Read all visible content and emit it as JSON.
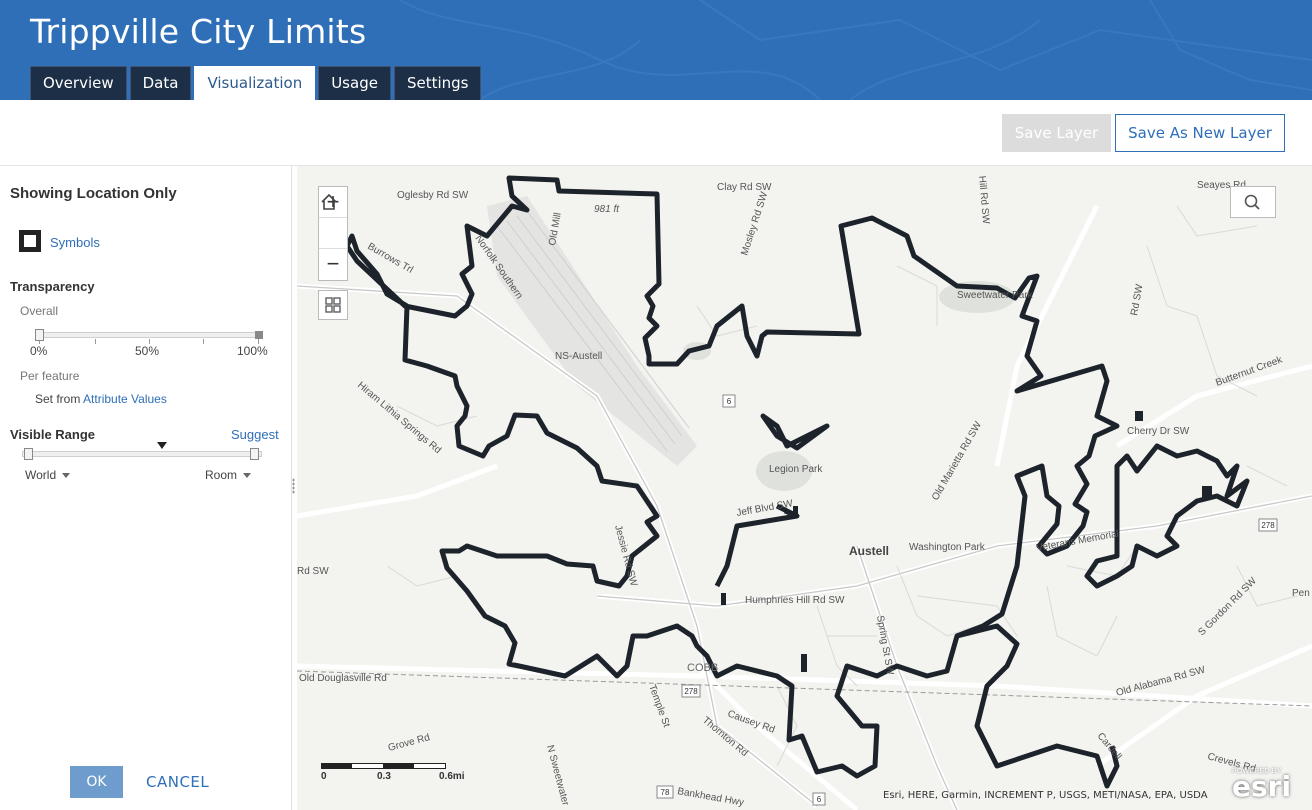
{
  "header": {
    "title": "Trippville City Limits",
    "tabs": [
      {
        "label": "Overview",
        "active": false
      },
      {
        "label": "Data",
        "active": false
      },
      {
        "label": "Visualization",
        "active": true
      },
      {
        "label": "Usage",
        "active": false
      },
      {
        "label": "Settings",
        "active": false
      }
    ]
  },
  "toolbar": {
    "save_label": "Save Layer",
    "save_as_label": "Save As New Layer"
  },
  "panel": {
    "heading": "Showing Location Only",
    "symbols_label": "Symbols",
    "transparency": {
      "heading": "Transparency",
      "overall_label": "Overall",
      "ticks": [
        "0%",
        "50%",
        "100%"
      ],
      "value_percent": 0,
      "per_feature_label": "Per feature",
      "set_from_label": "Set from",
      "attribute_values_link": "Attribute Values"
    },
    "visible_range": {
      "heading": "Visible Range",
      "suggest_link": "Suggest",
      "min_label": "World",
      "max_label": "Room"
    },
    "ok_label": "OK",
    "cancel_label": "CANCEL"
  },
  "map": {
    "zoom_in": "+",
    "zoom_out": "−",
    "attribution": "Esri, HERE, Garmin, INCREMENT P, USGS, METI/NASA, EPA, USDA",
    "powered_by": "POWERED BY",
    "logo_text": "esri",
    "scale_labels": [
      "0",
      "0.3",
      "0.6mi"
    ],
    "place_labels": [
      "Austell",
      "Legion Park",
      "Washington Park",
      "Sweetwater Park",
      "NS-Austell",
      "COBB",
      "Norfolk Southern",
      "981 ft"
    ],
    "road_labels": [
      "Oglesby Rd SW",
      "Clay Rd SW",
      "Seayes Rd",
      "Mosley Rd SW",
      "Burrows Trl",
      "Hiram Lithia Springs Rd",
      "Butternut Creek",
      "Cherry Dr SW",
      "Old Marietta Rd SW",
      "Veterans Memorial",
      "Humphries Hill Rd SW",
      "Spring St SW",
      "Old Douglasville Rd",
      "Old Alabama Rd SW",
      "S Gordon Rd SW",
      "Thornton Rd",
      "Causey Rd",
      "Grove Rd",
      "N Sweetwater",
      "Bankhead Hwy",
      "Temple St",
      "Hill Rd SW",
      "Rd SW",
      "Crevels Rd",
      "Cardell",
      "Pen",
      "Jessie Rd SW",
      "Rd SW",
      "Old Mill",
      "Jeff Blvd SW"
    ],
    "route_shields": [
      "6",
      "278",
      "78",
      "6",
      "278"
    ],
    "boundary_color": "#1d232b"
  }
}
